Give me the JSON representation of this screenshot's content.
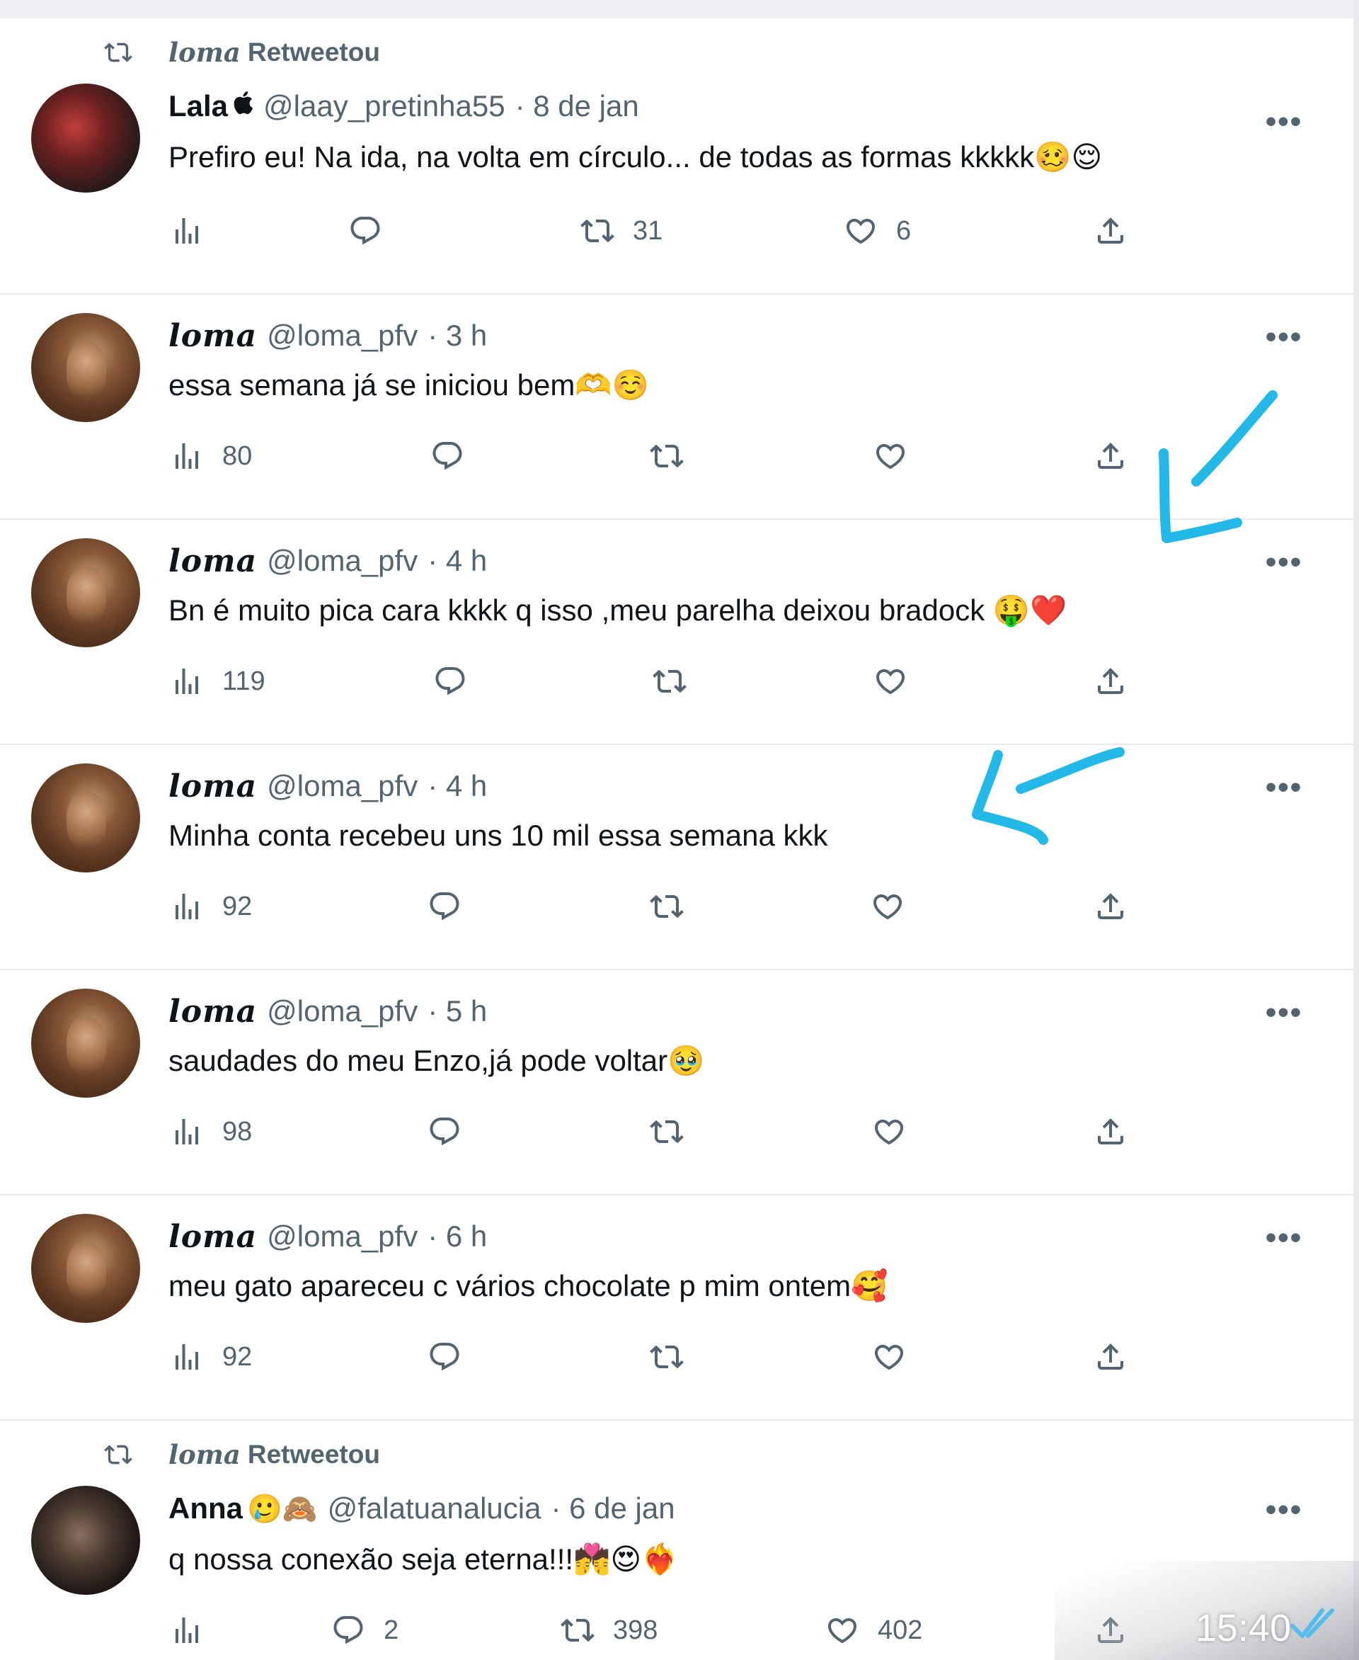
{
  "colors": {
    "text": "#0f1419",
    "muted": "#536471",
    "divider": "#e6e9ec",
    "annotation": "#22b8e8"
  },
  "tweets": [
    {
      "retweeted_by": "loma",
      "retweet_label": "Retweetou",
      "name": "Lala",
      "name_emoji": "",
      "handle": "@laay_pretinha55",
      "time": "· 8 de jan",
      "text": "Prefiro eu! Na ida, na volta em círculo... de todas as formas kkkkk🥴😌",
      "views": "",
      "replies": "",
      "retweets": "31",
      "likes": "6"
    },
    {
      "name": "loma",
      "handle": "@loma_pfv",
      "time": "· 3 h",
      "text": "essa semana já se iniciou bem🫶☺️",
      "views": "80",
      "replies": "",
      "retweets": "",
      "likes": ""
    },
    {
      "name": "loma",
      "handle": "@loma_pfv",
      "time": "· 4 h",
      "text": "Bn é muito pica cara kkkk q isso ,meu parelha deixou bradock 🤑❤️",
      "views": "119",
      "replies": "",
      "retweets": "",
      "likes": ""
    },
    {
      "name": "loma",
      "handle": "@loma_pfv",
      "time": "· 4 h",
      "text": "Minha conta recebeu uns 10 mil essa semana kkk",
      "views": "92",
      "replies": "",
      "retweets": "",
      "likes": ""
    },
    {
      "name": "loma",
      "handle": "@loma_pfv",
      "time": "· 5 h",
      "text": "saudades do meu Enzo,já pode voltar🥹",
      "views": "98",
      "replies": "",
      "retweets": "",
      "likes": ""
    },
    {
      "name": "loma",
      "handle": "@loma_pfv",
      "time": "· 6 h",
      "text": "meu gato apareceu c vários chocolate p mim ontem🥰",
      "views": "92",
      "replies": "",
      "retweets": "",
      "likes": ""
    },
    {
      "retweeted_by": "loma",
      "retweet_label": "Retweetou",
      "name": "Anna",
      "name_emoji": "🥲🙈",
      "handle": "@falatuanalucia",
      "time": "· 6 de jan",
      "text": "q nossa conexão seja eterna!!!💏😍❤️‍🔥",
      "views": "",
      "replies": "2",
      "retweets": "398",
      "likes": "402"
    }
  ],
  "icons": {
    "retweet_header": "retweet-icon",
    "views": "bar-chart-icon",
    "reply": "speech-bubble-icon",
    "retweet": "retweet-icon",
    "like": "heart-icon",
    "share": "share-upload-icon",
    "more": "more-dots-icon",
    "read_receipt": "double-check-icon"
  },
  "more_label": "•••",
  "status": {
    "time": "15:40"
  }
}
